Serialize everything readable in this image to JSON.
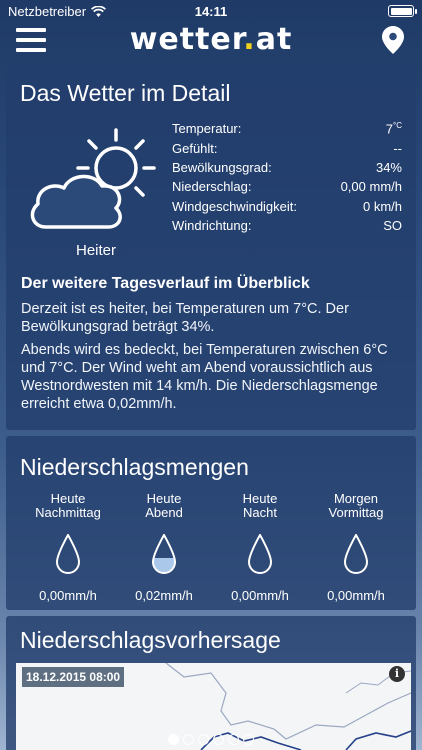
{
  "status": {
    "carrier": "Netzbetreiber",
    "time": "14:11"
  },
  "nav": {
    "logo_main": "wetter",
    "logo_dot": ".",
    "logo_tld": "at"
  },
  "detail": {
    "title": "Das Wetter im Detail",
    "condition": "Heiter",
    "condition_icon": "sun-behind-cloud-icon",
    "rows": [
      {
        "label": "Temperatur:",
        "value": "7",
        "unit": "°C"
      },
      {
        "label": "Gefühlt:",
        "value": "--"
      },
      {
        "label": "Bewölkungsgrad:",
        "value": "34%"
      },
      {
        "label": "Niederschlag:",
        "value": "0,00 mm/h"
      },
      {
        "label": "Windgeschwindigkeit:",
        "value": "0 km/h"
      },
      {
        "label": "Windrichtung:",
        "value": "SO"
      }
    ],
    "subheading": "Der weitere Tagesverlauf im Überblick",
    "para1": "Derzeit ist es heiter, bei Temperaturen um 7°C. Der Bewölkungsgrad beträgt 34%.",
    "para2": "Abends wird es bedeckt, bei Temperaturen zwischen 6°C und 7°C. Der Wind weht am Abend voraussichtlich aus Westnordwesten mit 14 km/h. Die Niederschlagsmenge erreicht etwa 0,02mm/h."
  },
  "precip": {
    "title": "Niederschlagsmengen",
    "columns": [
      {
        "line1": "Heute",
        "line2": "Nachmittag",
        "value": "0,00mm/h",
        "fill": 0
      },
      {
        "line1": "Heute",
        "line2": "Abend",
        "value": "0,02mm/h",
        "fill": 0.4
      },
      {
        "line1": "Heute",
        "line2": "Nacht",
        "value": "0,00mm/h",
        "fill": 0
      },
      {
        "line1": "Morgen",
        "line2": "Vormittag",
        "value": "0,00mm/h",
        "fill": 0
      }
    ]
  },
  "forecast": {
    "title": "Niederschlagsvorhersage",
    "timestamp": "18.12.2015 08:00",
    "info_glyph": "i"
  },
  "pager": {
    "count": 6,
    "active": 0
  },
  "colors": {
    "accent_yellow": "#f2d21a",
    "card_bg": "#223e6c",
    "drop_fill": "#a9c8ea"
  }
}
